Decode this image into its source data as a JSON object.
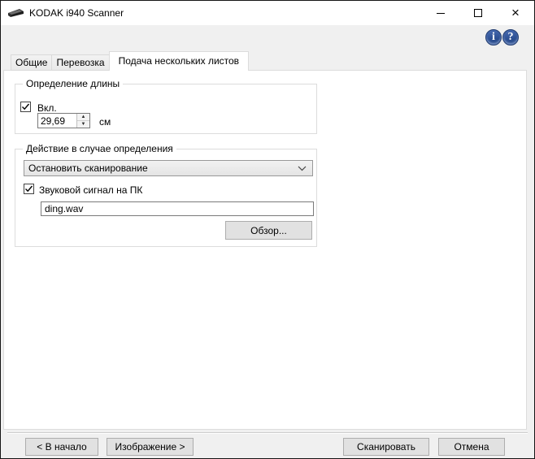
{
  "window": {
    "title": "KODAK i940 Scanner",
    "app_icon": "scanner"
  },
  "titlebar_controls": {
    "minimize": "minimize",
    "maximize": "maximize",
    "close_glyph": "×"
  },
  "header_icons": {
    "info_glyph": "i",
    "help_glyph": "?"
  },
  "tabs": [
    {
      "label": "Общие",
      "active": false
    },
    {
      "label": "Перевозка",
      "active": false
    },
    {
      "label": "Подача нескольких листов",
      "active": true
    }
  ],
  "length_detection": {
    "group_title": "Определение длины",
    "enable_label": "Вкл.",
    "enabled": true,
    "length_value": "29,69",
    "unit": "см"
  },
  "detection_action": {
    "group_title": "Действие в случае определения",
    "selected_action": "Остановить сканирование",
    "beep_label": "Звуковой сигнал на ПК",
    "beep_enabled": true,
    "sound_file": "ding.wav",
    "browse_label": "Обзор..."
  },
  "footer": {
    "back_label": "< В начало",
    "image_label": "Изображение >",
    "scan_label": "Сканировать",
    "cancel_label": "Отмена"
  },
  "icons": {
    "spin_up": "▲",
    "spin_down": "▼"
  },
  "colors": {
    "dialog_bg": "#f0f0f0",
    "titlebar_bg": "#ffffff",
    "panel_bg": "#ffffff",
    "info_help_blue": "#2c4f92",
    "button_face": "#e1e1e1",
    "button_border": "#adadad",
    "groupbox_border": "#dcdcdc"
  }
}
